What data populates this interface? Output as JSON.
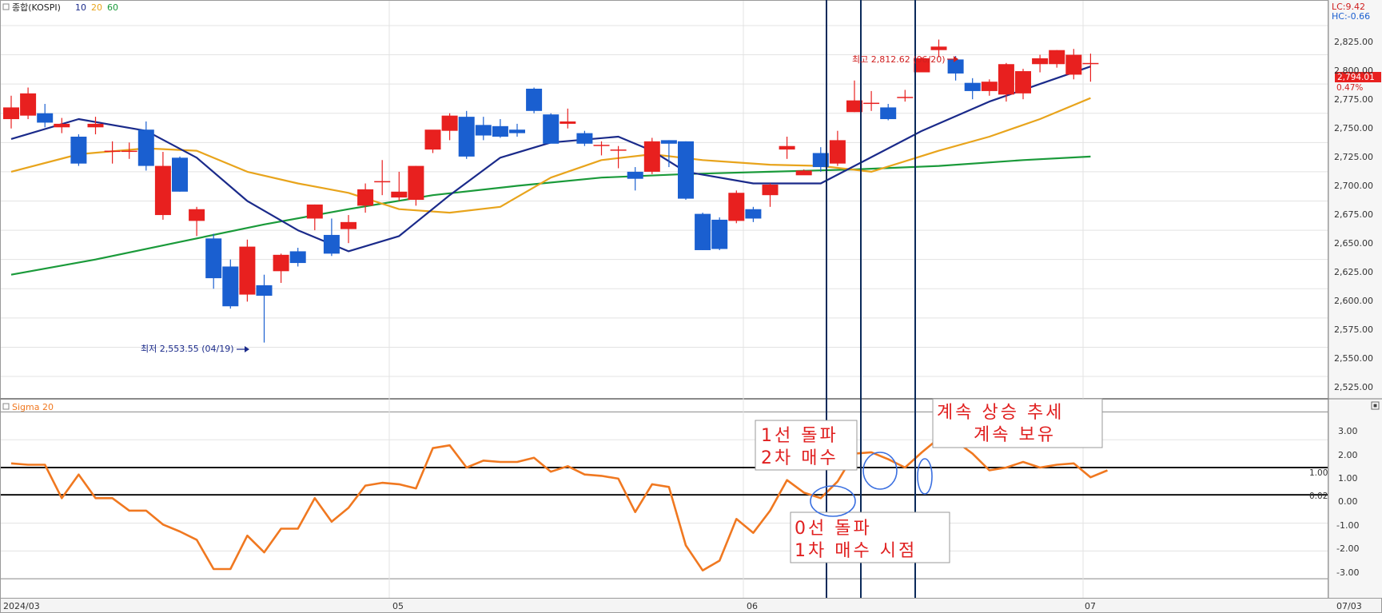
{
  "price_panel": {
    "title": "종합(KOSPI)",
    "ma_labels": [
      {
        "text": "10",
        "color": "#1a2a8a"
      },
      {
        "text": "20",
        "color": "#e8a41c"
      },
      {
        "text": "60",
        "color": "#1a9a3a"
      }
    ],
    "lc_label": "LC:9.42",
    "hc_label": "HC:-0.66",
    "current_price_label": "2,794.01",
    "change_label": "0.47%",
    "high_annotation": "최고 2,812.62 (06/20)",
    "low_annotation": "최저 2,553.55 (04/19)",
    "price_ticks": [
      "2,825.00",
      "2,800.00",
      "2,775.00",
      "2,750.00",
      "2,725.00",
      "2,700.00",
      "2,675.00",
      "2,650.00",
      "2,625.00",
      "2,600.00",
      "2,575.00",
      "2,550.00",
      "2,525.00"
    ]
  },
  "sigma_panel": {
    "title": "Sigma 20",
    "ticks": [
      "3.00",
      "2.00",
      "1.00",
      "0.00",
      "-1.00",
      "-2.00",
      "-3.00"
    ],
    "level_labels": [
      "1.00",
      "0.02"
    ],
    "notes": {
      "box1_line1": "1선 돌파",
      "box1_line2": "2차 매수",
      "box2_line1": "0선 돌파",
      "box2_line2": "1차 매수 시점",
      "box3_line1": "계속 상승 추세",
      "box3_line2": "계속 보유"
    }
  },
  "x_axis": {
    "labels": [
      "2024/03",
      "05",
      "06",
      "07",
      "07/03"
    ]
  },
  "colors": {
    "up": "#e8201f",
    "down": "#1a5fd0",
    "ma10": "#1a2a8a",
    "ma20": "#e8a41c",
    "ma60": "#1a9a3a",
    "sigma": "#f07820",
    "note_text": "#e02020",
    "vline": "#0b2a5a",
    "circle": "#3a6fe0"
  },
  "chart_data": {
    "type": "candlestick",
    "price": {
      "ylim": [
        2510,
        2840
      ],
      "candles": [
        {
          "o": 2745,
          "h": 2765,
          "l": 2737,
          "c": 2755
        },
        {
          "o": 2748,
          "h": 2772,
          "l": 2745,
          "c": 2767
        },
        {
          "o": 2750,
          "h": 2758,
          "l": 2738,
          "c": 2742
        },
        {
          "o": 2738,
          "h": 2746,
          "l": 2733,
          "c": 2741
        },
        {
          "o": 2730,
          "h": 2732,
          "l": 2705,
          "c": 2707
        },
        {
          "o": 2738,
          "h": 2747,
          "l": 2732,
          "c": 2741
        },
        {
          "o": 2717,
          "h": 2726,
          "l": 2707,
          "c": 2718
        },
        {
          "o": 2717,
          "h": 2725,
          "l": 2711,
          "c": 2718
        },
        {
          "o": 2736,
          "h": 2743,
          "l": 2701,
          "c": 2705
        },
        {
          "o": 2663,
          "h": 2717,
          "l": 2659,
          "c": 2705
        },
        {
          "o": 2712,
          "h": 2713,
          "l": 2683,
          "c": 2683
        },
        {
          "o": 2658,
          "h": 2670,
          "l": 2645,
          "c": 2668
        },
        {
          "o": 2643,
          "h": 2647,
          "l": 2600,
          "c": 2609
        },
        {
          "o": 2619,
          "h": 2625,
          "l": 2583,
          "c": 2585
        },
        {
          "o": 2595,
          "h": 2642,
          "l": 2589,
          "c": 2636
        },
        {
          "o": 2603,
          "h": 2612,
          "l": 2554,
          "c": 2594
        },
        {
          "o": 2615,
          "h": 2630,
          "l": 2605,
          "c": 2629
        },
        {
          "o": 2632,
          "h": 2635,
          "l": 2619,
          "c": 2622
        },
        {
          "o": 2660,
          "h": 2672,
          "l": 2650,
          "c": 2672
        },
        {
          "o": 2646,
          "h": 2660,
          "l": 2628,
          "c": 2630
        },
        {
          "o": 2651,
          "h": 2663,
          "l": 2639,
          "c": 2657
        },
        {
          "o": 2671,
          "h": 2690,
          "l": 2665,
          "c": 2685
        },
        {
          "o": 2692,
          "h": 2710,
          "l": 2680,
          "c": 2692
        },
        {
          "o": 2678,
          "h": 2700,
          "l": 2675,
          "c": 2683
        },
        {
          "o": 2676,
          "h": 2705,
          "l": 2671,
          "c": 2705
        },
        {
          "o": 2719,
          "h": 2735,
          "l": 2716,
          "c": 2736
        },
        {
          "o": 2735,
          "h": 2750,
          "l": 2727,
          "c": 2748
        },
        {
          "o": 2747,
          "h": 2752,
          "l": 2711,
          "c": 2713
        },
        {
          "o": 2740,
          "h": 2747,
          "l": 2727,
          "c": 2731
        },
        {
          "o": 2739,
          "h": 2745,
          "l": 2729,
          "c": 2730
        },
        {
          "o": 2736,
          "h": 2741,
          "l": 2730,
          "c": 2733
        },
        {
          "o": 2771,
          "h": 2772,
          "l": 2750,
          "c": 2752
        },
        {
          "o": 2749,
          "h": 2750,
          "l": 2725,
          "c": 2724
        },
        {
          "o": 2741,
          "h": 2754,
          "l": 2737,
          "c": 2743
        },
        {
          "o": 2733,
          "h": 2735,
          "l": 2722,
          "c": 2724
        },
        {
          "o": 2722,
          "h": 2726,
          "l": 2714,
          "c": 2723
        },
        {
          "o": 2719,
          "h": 2722,
          "l": 2703,
          "c": 2719
        },
        {
          "o": 2700,
          "h": 2704,
          "l": 2684,
          "c": 2694
        },
        {
          "o": 2700,
          "h": 2729,
          "l": 2698,
          "c": 2726
        },
        {
          "o": 2727,
          "h": 2727,
          "l": 2704,
          "c": 2724
        },
        {
          "o": 2726,
          "h": 2726,
          "l": 2676,
          "c": 2677
        },
        {
          "o": 2664,
          "h": 2665,
          "l": 2633,
          "c": 2633
        },
        {
          "o": 2659,
          "h": 2661,
          "l": 2633,
          "c": 2634
        },
        {
          "o": 2658,
          "h": 2684,
          "l": 2656,
          "c": 2682
        },
        {
          "o": 2668,
          "h": 2670,
          "l": 2657,
          "c": 2660
        },
        {
          "o": 2680,
          "h": 2690,
          "l": 2670,
          "c": 2689
        },
        {
          "o": 2719,
          "h": 2730,
          "l": 2711,
          "c": 2722
        },
        {
          "o": 2697,
          "h": 2702,
          "l": 2698,
          "c": 2701
        },
        {
          "o": 2716,
          "h": 2721,
          "l": 2700,
          "c": 2704
        },
        {
          "o": 2707,
          "h": 2735,
          "l": 2705,
          "c": 2727
        },
        {
          "o": 2751,
          "h": 2778,
          "l": 2751,
          "c": 2761
        },
        {
          "o": 2759,
          "h": 2769,
          "l": 2752,
          "c": 2759
        },
        {
          "o": 2755,
          "h": 2758,
          "l": 2744,
          "c": 2745
        },
        {
          "o": 2764,
          "h": 2770,
          "l": 2760,
          "c": 2764
        },
        {
          "o": 2785,
          "h": 2798,
          "l": 2785,
          "c": 2797
        },
        {
          "o": 2804,
          "h": 2813,
          "l": 2798,
          "c": 2807
        },
        {
          "o": 2796,
          "h": 2799,
          "l": 2778,
          "c": 2784
        },
        {
          "o": 2776,
          "h": 2780,
          "l": 2762,
          "c": 2769
        },
        {
          "o": 2769,
          "h": 2779,
          "l": 2765,
          "c": 2777
        },
        {
          "o": 2766,
          "h": 2793,
          "l": 2760,
          "c": 2792
        },
        {
          "o": 2767,
          "h": 2788,
          "l": 2762,
          "c": 2786
        },
        {
          "o": 2792,
          "h": 2800,
          "l": 2785,
          "c": 2797
        },
        {
          "o": 2792,
          "h": 2804,
          "l": 2789,
          "c": 2804
        },
        {
          "o": 2783,
          "h": 2805,
          "l": 2779,
          "c": 2800
        },
        {
          "o": 2792,
          "h": 2801,
          "l": 2777,
          "c": 2793
        }
      ],
      "ma10": [
        [
          0,
          2728
        ],
        [
          4,
          2745
        ],
        [
          8,
          2735
        ],
        [
          11,
          2712
        ],
        [
          14,
          2675
        ],
        [
          17,
          2650
        ],
        [
          20,
          2632
        ],
        [
          23,
          2645
        ],
        [
          26,
          2680
        ],
        [
          29,
          2712
        ],
        [
          32,
          2725
        ],
        [
          36,
          2730
        ],
        [
          38,
          2718
        ],
        [
          40,
          2700
        ],
        [
          44,
          2690
        ],
        [
          48,
          2690
        ],
        [
          50,
          2705
        ],
        [
          54,
          2735
        ],
        [
          58,
          2760
        ],
        [
          61,
          2775
        ],
        [
          64,
          2790
        ]
      ],
      "ma20": [
        [
          0,
          2700
        ],
        [
          4,
          2715
        ],
        [
          8,
          2720
        ],
        [
          11,
          2718
        ],
        [
          14,
          2700
        ],
        [
          17,
          2690
        ],
        [
          20,
          2682
        ],
        [
          23,
          2668
        ],
        [
          26,
          2665
        ],
        [
          29,
          2670
        ],
        [
          32,
          2695
        ],
        [
          35,
          2710
        ],
        [
          38,
          2715
        ],
        [
          41,
          2710
        ],
        [
          45,
          2706
        ],
        [
          48,
          2705
        ],
        [
          51,
          2700
        ],
        [
          55,
          2718
        ],
        [
          58,
          2730
        ],
        [
          61,
          2745
        ],
        [
          64,
          2763
        ]
      ],
      "ma60": [
        [
          0,
          2612
        ],
        [
          5,
          2625
        ],
        [
          10,
          2640
        ],
        [
          15,
          2655
        ],
        [
          20,
          2668
        ],
        [
          25,
          2680
        ],
        [
          30,
          2688
        ],
        [
          35,
          2695
        ],
        [
          40,
          2698
        ],
        [
          45,
          2700
        ],
        [
          50,
          2702
        ],
        [
          55,
          2705
        ],
        [
          60,
          2710
        ],
        [
          64,
          2713
        ]
      ]
    },
    "sigma": {
      "ylim": [
        -3.6,
        3.3
      ],
      "values": [
        1.15,
        1.1,
        1.1,
        -0.1,
        0.75,
        -0.1,
        -0.1,
        -0.55,
        -0.55,
        -1.05,
        -1.3,
        -1.6,
        -2.65,
        -2.65,
        -1.45,
        -2.05,
        -1.2,
        -1.2,
        -0.1,
        -0.95,
        -0.45,
        0.35,
        0.45,
        0.4,
        0.25,
        1.7,
        1.8,
        1.0,
        1.25,
        1.2,
        1.2,
        1.35,
        0.85,
        1.05,
        0.75,
        0.7,
        0.6,
        -0.6,
        0.4,
        0.3,
        -1.8,
        -2.7,
        -2.35,
        -0.85,
        -1.35,
        -0.55,
        0.55,
        0.1,
        -0.1,
        0.5,
        1.5,
        1.55,
        1.3,
        1.0,
        1.55,
        2.05,
        1.95,
        1.5,
        0.9,
        1.0,
        1.2,
        1.0,
        1.1,
        1.15,
        0.65,
        0.9
      ]
    }
  }
}
